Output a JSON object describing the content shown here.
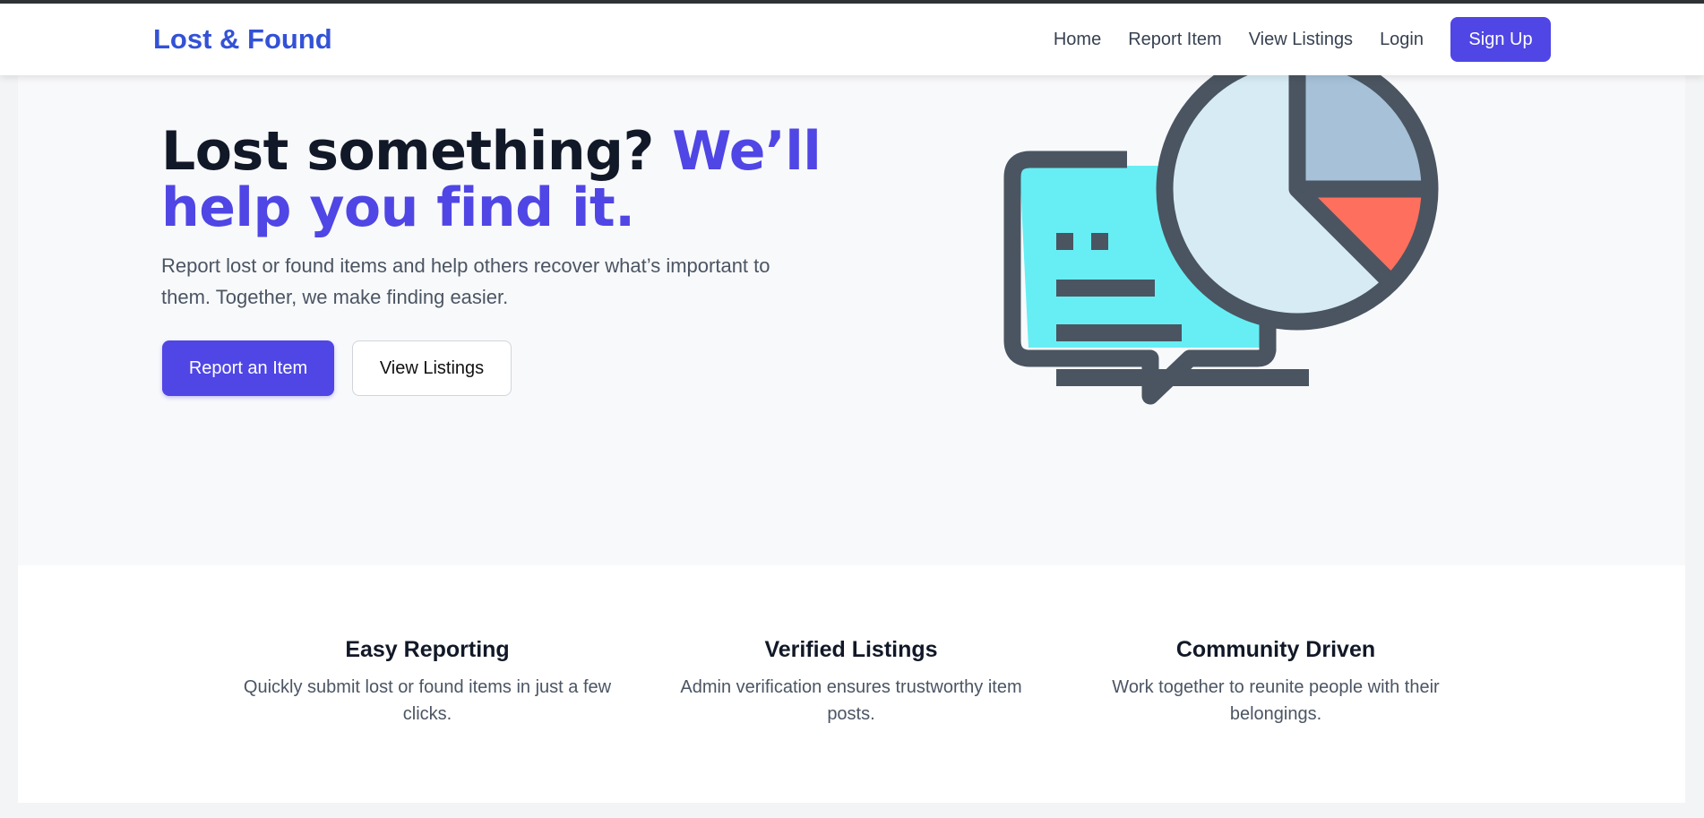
{
  "brand": "Lost & Found",
  "nav": {
    "links": [
      "Home",
      "Report Item",
      "View Listings",
      "Login"
    ],
    "signup_label": "Sign Up"
  },
  "hero": {
    "title_dark": "Lost something? ",
    "title_accent": "We’ll help you find it.",
    "subtitle": "Report lost or found items and help others recover what’s important to them. Together, we make finding easier.",
    "primary_button": "Report an Item",
    "secondary_button": "View Listings",
    "illustration_icon": "chat-bubble-pie-chart-icon"
  },
  "features": [
    {
      "title": "Easy Reporting",
      "description": "Quickly submit lost or found items in just a few clicks."
    },
    {
      "title": "Verified Listings",
      "description": "Admin verification ensures trustworthy item posts."
    },
    {
      "title": "Community Driven",
      "description": "Work together to reunite people with their belongings."
    }
  ],
  "colors": {
    "brand": "#3352d6",
    "accent": "#4f46e5",
    "illustration_cyan": "#67eef4",
    "illustration_outline": "#4a5561",
    "pie_light": "#d7ebf5",
    "pie_blue": "#a6c1d8",
    "pie_red": "#ff6f5d"
  }
}
